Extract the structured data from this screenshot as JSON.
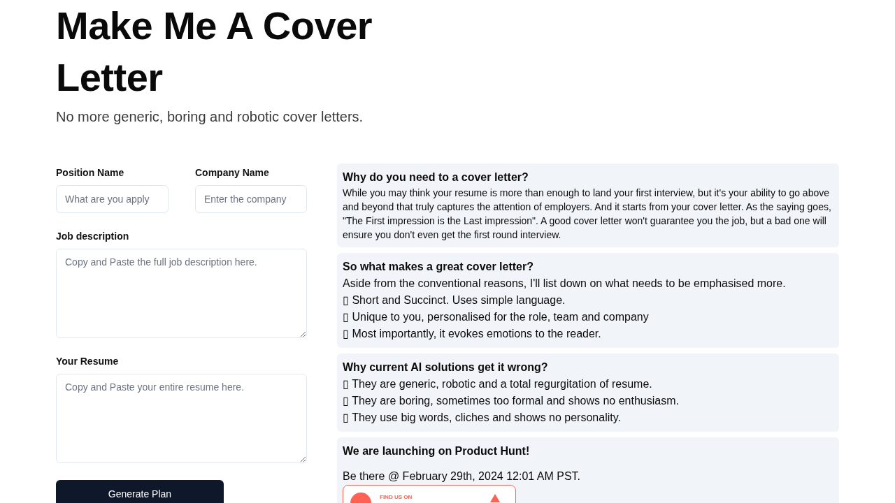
{
  "header": {
    "title": "Make Me A Cover Letter",
    "subtitle": "No more generic, boring and robotic cover letters."
  },
  "form": {
    "fields": [
      {
        "label": "Position Name",
        "placeholder": "What are you apply",
        "kind": "input"
      },
      {
        "label": "Company Name",
        "placeholder": "Enter the company",
        "kind": "input"
      },
      {
        "label": "Job description",
        "placeholder": "Copy and Paste the full job description here.",
        "kind": "textarea"
      },
      {
        "label": "Your Resume",
        "placeholder": "Copy and Paste your entire resume here.",
        "kind": "textarea"
      }
    ],
    "button": "Generate Plan"
  },
  "cards": [
    {
      "kind": "paragraph",
      "title": "Why do you need to a cover letter?",
      "lines": [
        "While you may think your resume is more than enough to land your first interview, but it's your ability to go above and beyond that truly captures the attention of employers. And it starts from your cover letter. As the saying goes, \"The First impression is the Last impression\". A good cover letter won't guarantee you the job, but a bad one will ensure you don't even get the first round interview."
      ]
    },
    {
      "kind": "list",
      "title": "So what makes a great cover letter?",
      "lines": [
        "Aside from the conventional reasons, I'll list down on what needs to be emphasised more.",
        "▯ Short and Succinct. Uses simple language.",
        "▯ Unique to you, personalised for the role, team and company",
        "▯ Most importantly, it evokes emotions to the reader."
      ]
    },
    {
      "kind": "list",
      "title": "Why current AI solutions get it wrong?",
      "lines": [
        "▯ They are generic, robotic and a total regurgitation of resume.",
        "▯ They are boring, sometimes too formal and shows no enthusiasm.",
        "▯ They use big words, cliches and shows no personality."
      ]
    },
    {
      "kind": "launch",
      "title": "We are launching on Product Hunt!",
      "lines": [
        "Be there @ February 29th, 2024 12:01 AM PST."
      ],
      "badge": {
        "caption": "FIND US ON"
      }
    }
  ]
}
